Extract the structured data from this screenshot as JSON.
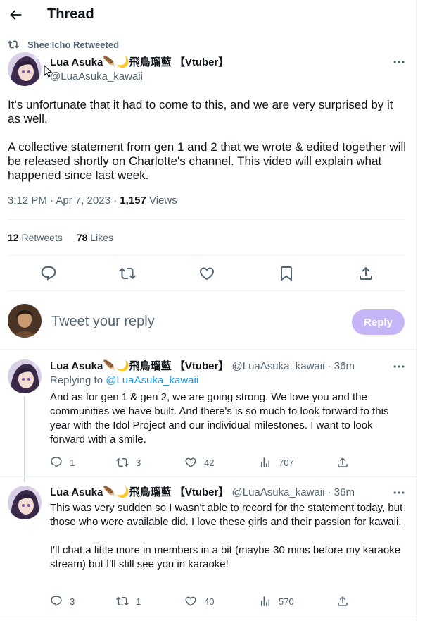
{
  "header": {
    "title": "Thread"
  },
  "retweet_context": {
    "label": "Shee Icho Retweeted"
  },
  "main_tweet": {
    "author_name": "Lua Asuka🪶🌙飛鳥瑠藍 【Vtuber】",
    "handle": "@LuaAsuka_kawaii",
    "text": "It's unfortunate that it had to come to this, and we are very surprised by it as well.\n\nA collective statement from gen 1 and 2 that we wrote & edited together will be released shortly on Charlotte's channel. This video will explain what happened since last week.",
    "time": "3:12 PM · Apr 7, 2023 · ",
    "views_count": "1,157",
    "views_label": " Views",
    "retweets_count": "12",
    "retweets_label": "Retweets",
    "likes_count": "78",
    "likes_label": "Likes"
  },
  "reply_box": {
    "placeholder": "Tweet your reply",
    "button_label": "Reply"
  },
  "replies": [
    {
      "author_name": "Lua Asuka🪶🌙飛鳥瑠藍 【Vtuber】",
      "handle": "@LuaAsuka_kawaii",
      "age": "· 36m",
      "replying_prefix": "Replying to ",
      "replying_to": "@LuaAsuka_kawaii",
      "text": "And as for gen 1 & gen 2, we are going strong. We love you and the communities we have built. And there's is so much to look forward to this year with the Idol Project and our individual milestones. I want to look forward with a smile.",
      "replies": "1",
      "retweets": "3",
      "likes": "42",
      "views": "707"
    },
    {
      "author_name": "Lua Asuka🪶🌙飛鳥瑠藍 【Vtuber】",
      "handle": "@LuaAsuka_kawaii",
      "age": "· 36m",
      "text": "This was very sudden so I wasn't able to record for the statement today, but those who were available did. I love these girls and their passion for kawaii.\n\nI'll chat a little more in members in a bit (maybe 30 mins before my karaoke stream) but I'll still see you in karaoke!",
      "replies": "3",
      "retweets": "1",
      "likes": "40",
      "views": "570"
    }
  ],
  "colors": {
    "accent": "#1d9bf0",
    "reply_button": "#c5b5f7",
    "muted": "#536471"
  },
  "icons": [
    "back-arrow-icon",
    "retweet-icon",
    "more-icon",
    "reply-icon",
    "like-icon",
    "bookmark-icon",
    "share-icon",
    "views-icon"
  ]
}
